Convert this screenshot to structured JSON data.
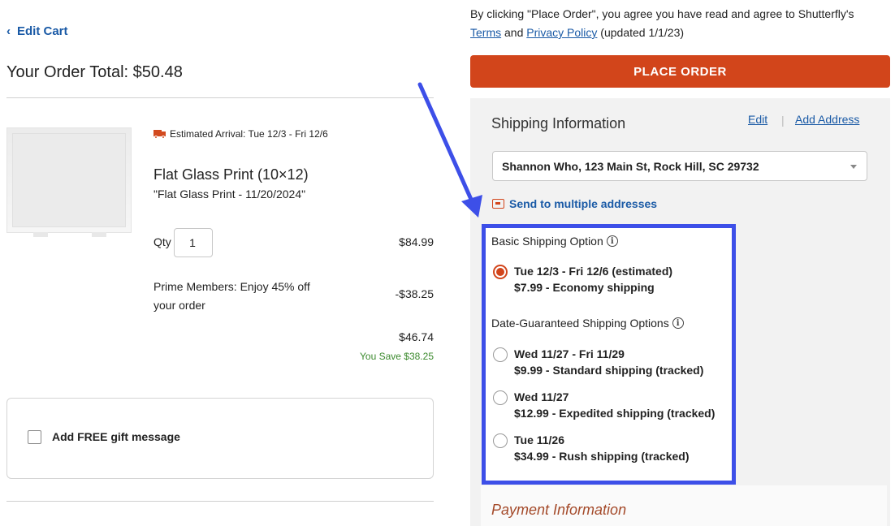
{
  "nav": {
    "edit_cart": "Edit Cart"
  },
  "order": {
    "total_label": "Your Order Total: $50.48"
  },
  "item": {
    "arrival": "Estimated Arrival: Tue 12/3 - Fri 12/6",
    "name": "Flat Glass Print (10×12)",
    "project": "\"Flat Glass Print - 11/20/2024\"",
    "qty_label": "Qty",
    "qty_value": "1",
    "price": "$84.99",
    "discount_label": "Prime Members: Enjoy 45% off your order",
    "discount_value": "-$38.25",
    "subtotal": "$46.74",
    "savings": "You Save $38.25"
  },
  "gift": {
    "label": "Add FREE gift message",
    "checked": false
  },
  "consent": {
    "prefix": "By clicking \"Place Order\", you agree you have read and agree to Shutterfly's",
    "terms": "Terms",
    "and": "and",
    "privacy": "Privacy Policy",
    "updated": "(updated 1/1/23)"
  },
  "place_order": {
    "label": "PLACE ORDER",
    "color": "#d2451b"
  },
  "shipping": {
    "title": "Shipping Information",
    "edit": "Edit",
    "separator": "|",
    "add_address": "Add Address",
    "address": "Shannon Who, 123 Main St, Rock Hill, SC 29732",
    "multi_link": "Send to multiple addresses",
    "basic_heading": "Basic Shipping Option",
    "guaranteed_heading": "Date-Guaranteed Shipping Options",
    "options": [
      {
        "dates": "Tue 12/3 - Fri 12/6 (estimated)",
        "price": "$7.99 - Economy shipping",
        "selected": true
      },
      {
        "dates": "Wed 11/27 - Fri 11/29",
        "price": "$9.99 - Standard shipping (tracked)",
        "selected": false
      },
      {
        "dates": "Wed 11/27",
        "price": "$12.99 - Expedited shipping (tracked)",
        "selected": false
      },
      {
        "dates": "Tue 11/26",
        "price": "$34.99 - Rush shipping (tracked)",
        "selected": false
      }
    ],
    "highlight_color": "#3d4fe8"
  },
  "payment": {
    "title": "Payment Information"
  }
}
